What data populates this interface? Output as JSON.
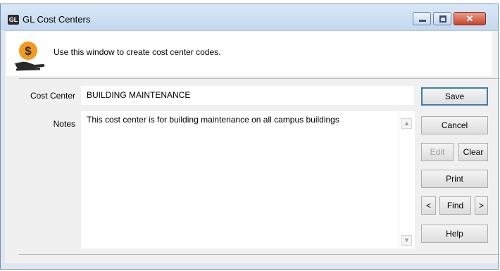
{
  "window": {
    "icon_text": "GL",
    "title": "GL Cost Centers"
  },
  "info": {
    "text": "Use this window to create cost center codes.",
    "icon": "money-hand-icon"
  },
  "form": {
    "cost_center_label": "Cost Center",
    "cost_center_value": "BUILDING MAINTENANCE",
    "notes_label": "Notes",
    "notes_value": "This cost center is for building maintenance on all campus buildings"
  },
  "buttons": {
    "save": "Save",
    "cancel": "Cancel",
    "edit": "Edit",
    "clear": "Clear",
    "print": "Print",
    "prev": "<",
    "find": "Find",
    "next": ">",
    "help": "Help"
  },
  "colors": {
    "title_bar": "#c3d8ef",
    "close_button": "#c6452c",
    "save_border": "#3c7fb1",
    "icon_orange": "#f39a1e"
  }
}
